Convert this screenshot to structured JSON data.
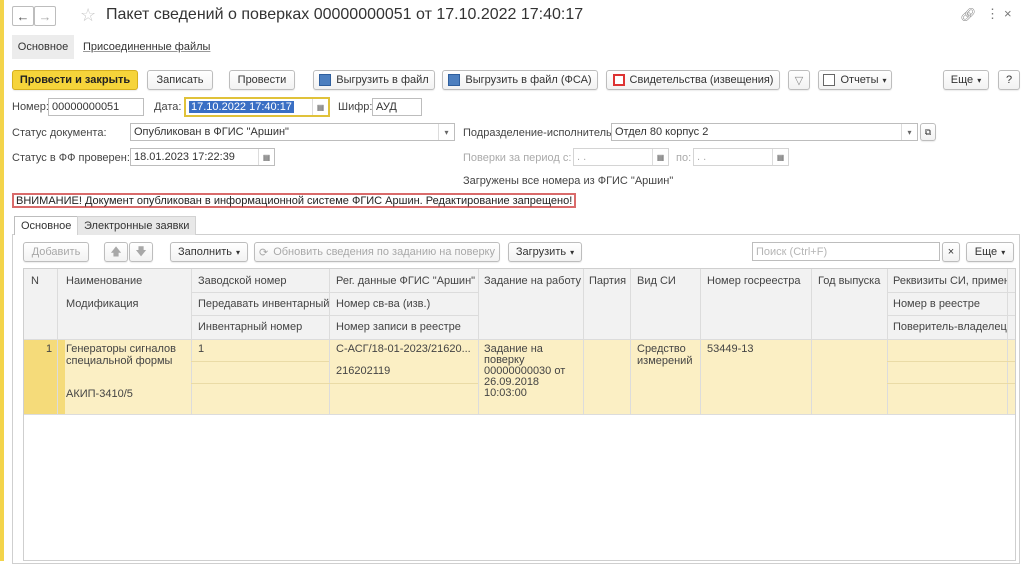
{
  "window": {
    "title": "Пакет сведений о поверках 00000000051 от 17.10.2022 17:40:17"
  },
  "form_tabs": {
    "main": "Основное",
    "attached": "Присоединенные файлы"
  },
  "toolbar": {
    "post_close": "Провести и закрыть",
    "save": "Записать",
    "post": "Провести",
    "export": "Выгрузить в файл",
    "export_fsa": "Выгрузить в файл (ФСА)",
    "certificates": "Свидетельства (извещения)",
    "reports": "Отчеты",
    "more": "Еще",
    "help": "?"
  },
  "fields": {
    "number_label": "Номер:",
    "number_value": "00000000051",
    "date_label": "Дата:",
    "date_value": "17.10.2022 17:40:17",
    "cipher_label": "Шифр:",
    "cipher_value": "АУД",
    "status_label": "Статус документа:",
    "status_value": "Опубликован в ФГИС \"Аршин\"",
    "division_label": "Подразделение-исполнитель:",
    "division_value": "Отдел 80 корпус 2",
    "checked_label": "Статус в ФФ проверен:",
    "checked_value": "18.01.2023 17:22:39",
    "period_label": "Поверки за период с:",
    "period_from": ". .",
    "period_to_label": "по:",
    "period_to": ". .",
    "loaded_note": "Загружены все номера из ФГИС \"Аршин\""
  },
  "warning": "ВНИМАНИЕ! Документ опубликован в информационной системе ФГИС Аршин. Редактирование запрещено!",
  "inner_tabs": {
    "main": "Основное",
    "requests": "Электронные заявки"
  },
  "grid_toolbar": {
    "add": "Добавить",
    "fill": "Заполнить",
    "refresh": "Обновить сведения по заданию на поверку",
    "load": "Загрузить",
    "search_placeholder": "Поиск (Ctrl+F)",
    "clear": "×",
    "more": "Еще"
  },
  "columns": {
    "n": "N",
    "name": "Наименование",
    "modification": "Модификация",
    "serial": "Заводской номер",
    "transfer_inv": "Передавать инвентарный",
    "inv_number": "Инвентарный номер",
    "reg": "Рег. данные ФГИС \"Аршин\"",
    "cert_number": "Номер св-ва (изв.)",
    "record_number": "Номер записи в реестре",
    "task": "Задание на работу",
    "batch": "Партия",
    "si_type": "Вид СИ",
    "registry": "Номер госреестра",
    "year": "Год выпуска",
    "requisites": "Реквизиты СИ, применяе",
    "registry_number": "Номер в реестре",
    "owner": "Поверитель-владелец"
  },
  "rows": [
    {
      "n": "1",
      "name_line1": "Генераторы сигналов",
      "name_line2": "специальной формы",
      "modification": "АКИП-3410/5",
      "serial": "1",
      "reg": "С-АСГ/18-01-2023/21620...",
      "cert": "216202119",
      "task_l1": "Задание на",
      "task_l2": "поверку",
      "task_l3": "00000000030 от",
      "task_l4": "26.09.2018",
      "task_l5": "10:03:00",
      "si_type_l1": "Средство",
      "si_type_l2": "измерений",
      "registry": "53449-13"
    }
  ]
}
